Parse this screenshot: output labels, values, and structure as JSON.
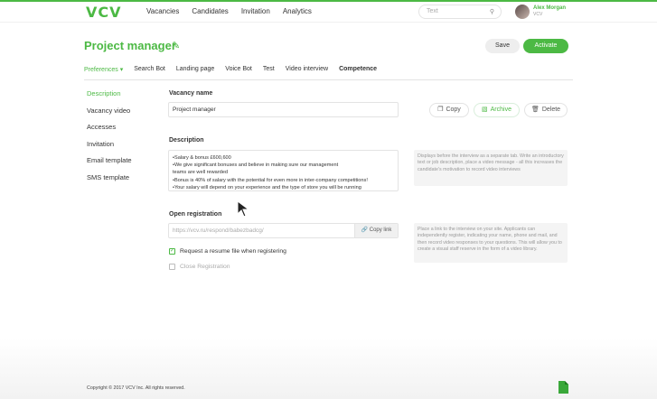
{
  "header": {
    "logo": "VCV",
    "nav": [
      "Vacancies",
      "Candidates",
      "Invitation",
      "Analytics"
    ],
    "search_placeholder": "Text",
    "user_name": "Alex Morgan",
    "user_org": "VCV"
  },
  "page": {
    "title": "Project manager",
    "save_label": "Save",
    "activate_label": "Activate",
    "tabs": [
      "Preferences",
      "Search Bot",
      "Landing page",
      "Voice Bot",
      "Test",
      "Video interview",
      "Competence"
    ]
  },
  "sidebar": {
    "items": [
      "Description",
      "Vacancy video",
      "Accesses",
      "Invitation",
      "Email template",
      "SMS template"
    ]
  },
  "form": {
    "vacancy_name_label": "Vacancy name",
    "vacancy_name_value": "Project manager",
    "copy_label": "Copy",
    "archive_label": "Archive",
    "delete_label": "Delete",
    "description_label": "Description",
    "description_lines": [
      "•Salary & bonus £600,600",
      "•We give significant bonuses and believe in making sure our management",
      "teams are well rewarded",
      "•Bonus is 40% of salary with the potential for even more in inter-company competitions!",
      "•Your salary will depend on your experience and the type of store you will be running"
    ],
    "description_hint": "Displays before the interview as a separate tab. Write an introductory text or job description, place a video message - all this increases the candidate's motivation to record video interviews",
    "open_registration_label": "Open registration",
    "registration_url": "https://vcv.ru/respond/babezbadcg/",
    "copy_link_label": "Copy link",
    "registration_hint": "Place a link to the interview on your site. Applicants can independently register, indicating your name, phone and mail, and then record video responses to your questions. This will allow you to create a visual staff reserve in the form of a video library.",
    "resume_checkbox_label": "Request a resume file when registering",
    "close_registration_label": "Close Registration"
  },
  "footer": {
    "copyright": "Copyright © 2017 VCV Inc. All rights reserved."
  },
  "colors": {
    "accent": "#4cb944"
  }
}
